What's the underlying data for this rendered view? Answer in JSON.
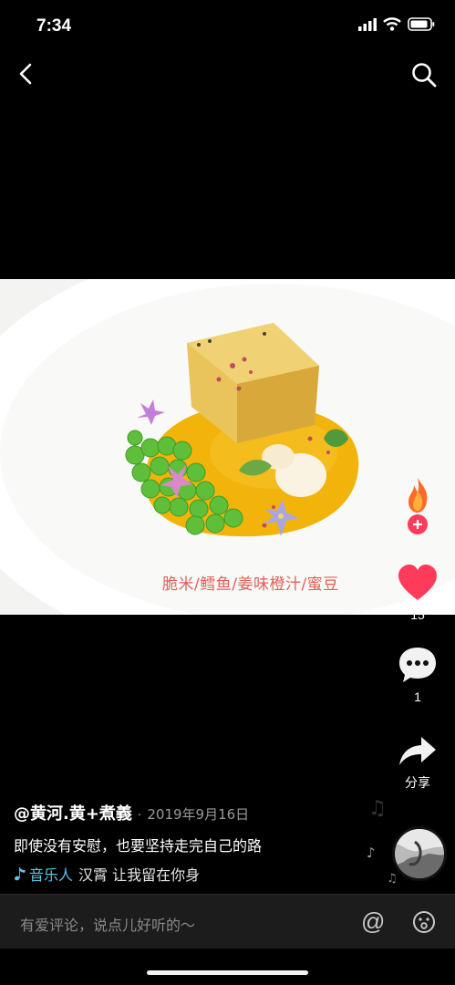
{
  "status_bar": {
    "time": "7:34"
  },
  "video": {
    "caption": "脆米/鳕鱼/姜味橙汁/蜜豆"
  },
  "actions": {
    "like_count": "15",
    "comment_count": "1",
    "share_label": "分享"
  },
  "post": {
    "author": "@黄河.黄+煮義",
    "date": "2019年9月16日",
    "description": "即使没有安慰，也要坚持走完自己的路",
    "music_label": "音乐人",
    "music_title": "汉霄    让我留在你身"
  },
  "comment_bar": {
    "placeholder": "有爱评论，说点儿好听的～"
  },
  "colors": {
    "like": "#ff3b5c",
    "music": "#5ec2e8",
    "caption": "#e0605a"
  }
}
